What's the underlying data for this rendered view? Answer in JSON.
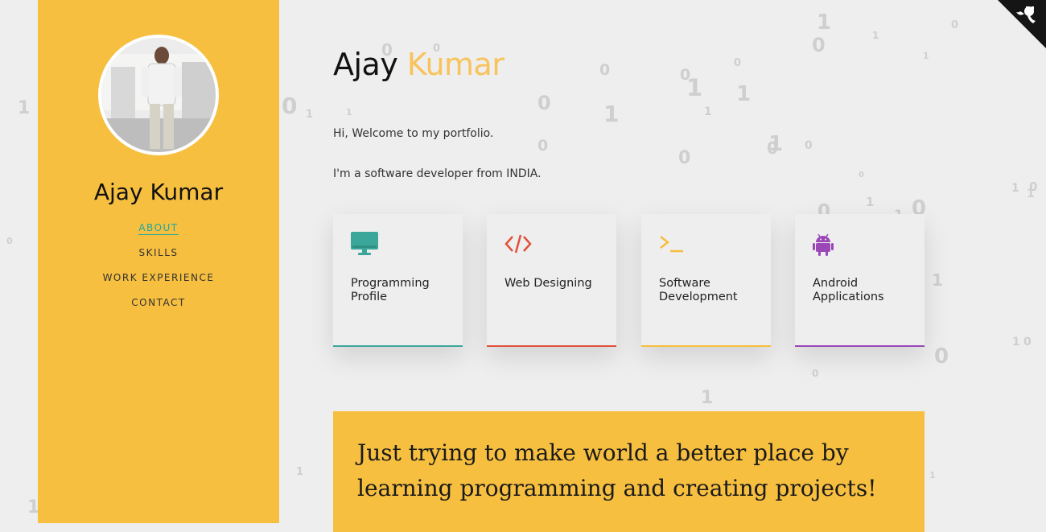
{
  "colors": {
    "sidebar": "#f7bf3f",
    "accent_name": "#f7c35a",
    "teal": "#3aa79a",
    "red": "#e0503a",
    "yellow": "#f6be3d",
    "purple": "#9b47b8",
    "page_bg": "#eeeeee"
  },
  "sidebar": {
    "name": "Ajay Kumar",
    "nav": [
      {
        "label": "ABOUT",
        "active": true
      },
      {
        "label": "SKILLS",
        "active": false
      },
      {
        "label": "WORK EXPERIENCE",
        "active": false
      },
      {
        "label": "CONTACT",
        "active": false
      }
    ]
  },
  "hero": {
    "first_name": "Ajay",
    "last_name": "Kumar",
    "intro_line1": "Hi, Welcome to my portfolio.",
    "intro_line2": "I'm a software developer from INDIA."
  },
  "cards": [
    {
      "title": "Programming Profile",
      "icon": "monitor-icon",
      "color": "#3aa79a"
    },
    {
      "title": "Web Designing",
      "icon": "code-icon",
      "color": "#e0503a"
    },
    {
      "title": "Software Development",
      "icon": "terminal-icon",
      "color": "#f6be3d"
    },
    {
      "title": "Android Applications",
      "icon": "android-icon",
      "color": "#9b47b8"
    }
  ],
  "quote": {
    "text_line1": "Just trying to make world a better place by",
    "text_line2": "learning programming and creating projects!"
  },
  "corner": {
    "icon": "github-octocat-icon"
  },
  "background": {
    "pattern": "binary-digits"
  }
}
